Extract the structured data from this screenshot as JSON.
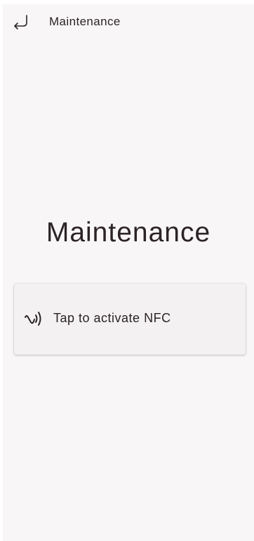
{
  "topbar": {
    "back_icon": "return-arrow-icon",
    "title": "Maintenance"
  },
  "main": {
    "heading": "Maintenance",
    "nfc_card": {
      "icon": "nfc-icon",
      "label": "Tap to activate NFC"
    }
  },
  "colors": {
    "background": "#f9f6f7",
    "card_background": "#f3f1f1",
    "text": "#2b2326"
  }
}
